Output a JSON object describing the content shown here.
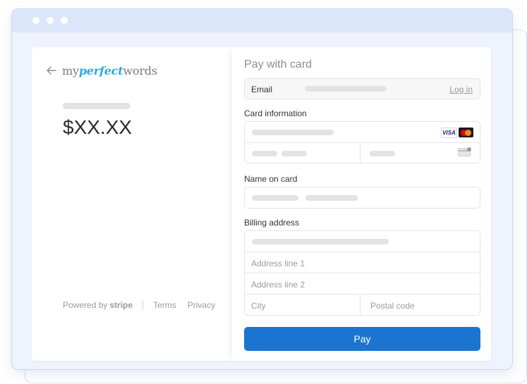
{
  "left": {
    "logo": {
      "part1": "my",
      "part2": "perfect",
      "part3": "words"
    },
    "price": "$XX.XX",
    "footer": {
      "powered_by": "Powered by",
      "stripe": "stripe",
      "terms": "Terms",
      "privacy": "Privacy"
    }
  },
  "right": {
    "title": "Pay with card",
    "email": {
      "label": "Email",
      "login": "Log in"
    },
    "card_label": "Card information",
    "visa": "VISA",
    "name_label": "Name on card",
    "billing_label": "Billing address",
    "address1_placeholder": "Address line 1",
    "address2_placeholder": "Address line 2",
    "city_placeholder": "City",
    "postal_placeholder": "Postal code",
    "pay_label": "Pay"
  },
  "colors": {
    "accent": "#1b75d0",
    "logo_accent": "#27a9e1",
    "frame": "#dbe6fb"
  }
}
